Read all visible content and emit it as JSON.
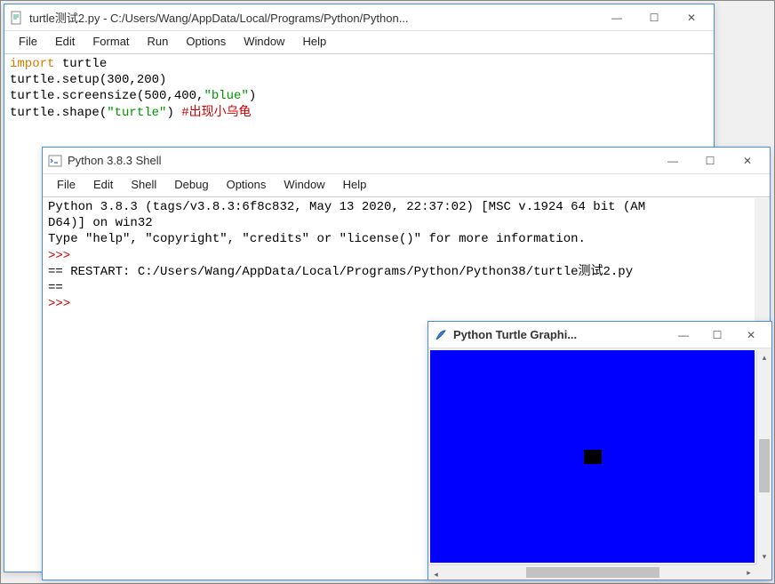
{
  "editor": {
    "title": "turtle测试2.py - C:/Users/Wang/AppData/Local/Programs/Python/Python...",
    "menu": [
      "File",
      "Edit",
      "Format",
      "Run",
      "Options",
      "Window",
      "Help"
    ],
    "code": {
      "line1_kw": "import",
      "line1_rest": " turtle",
      "line2": "turtle.setup(300,200)",
      "line3a": "turtle.screensize(500,400,",
      "line3b": "\"blue\"",
      "line3c": ")",
      "line4a": "turtle.shape(",
      "line4b": "\"turtle\"",
      "line4c": ") ",
      "line4d": "#出现小乌龟"
    }
  },
  "shell": {
    "title": "Python 3.8.3 Shell",
    "menu": [
      "File",
      "Edit",
      "Shell",
      "Debug",
      "Options",
      "Window",
      "Help"
    ],
    "banner1": "Python 3.8.3 (tags/v3.8.3:6f8c832, May 13 2020, 22:37:02) [MSC v.1924 64 bit (AM",
    "banner2": "D64)] on win32",
    "banner3": "Type \"help\", \"copyright\", \"credits\" or \"license()\" for more information.",
    "prompt": ">>>",
    "restart": "== RESTART: C:/Users/Wang/AppData/Local/Programs/Python/Python38/turtle测试2.py ",
    "restart2": "=="
  },
  "turtle": {
    "title": "Python Turtle Graphi...",
    "canvas_color": "#0000ff"
  },
  "controls": {
    "minimize": "—",
    "maximize": "☐",
    "close": "✕"
  }
}
